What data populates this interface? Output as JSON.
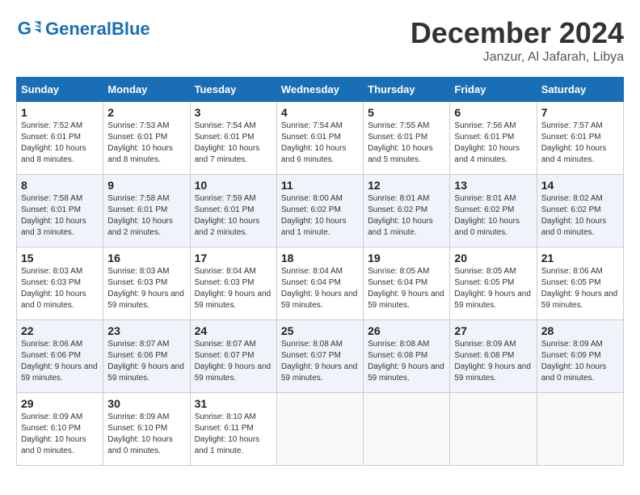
{
  "header": {
    "logo_general": "General",
    "logo_blue": "Blue",
    "month": "December 2024",
    "location": "Janzur, Al Jafarah, Libya"
  },
  "weekdays": [
    "Sunday",
    "Monday",
    "Tuesday",
    "Wednesday",
    "Thursday",
    "Friday",
    "Saturday"
  ],
  "weeks": [
    [
      {
        "day": 1,
        "sunrise": "7:52 AM",
        "sunset": "6:01 PM",
        "daylight": "10 hours and 8 minutes."
      },
      {
        "day": 2,
        "sunrise": "7:53 AM",
        "sunset": "6:01 PM",
        "daylight": "10 hours and 8 minutes."
      },
      {
        "day": 3,
        "sunrise": "7:54 AM",
        "sunset": "6:01 PM",
        "daylight": "10 hours and 7 minutes."
      },
      {
        "day": 4,
        "sunrise": "7:54 AM",
        "sunset": "6:01 PM",
        "daylight": "10 hours and 6 minutes."
      },
      {
        "day": 5,
        "sunrise": "7:55 AM",
        "sunset": "6:01 PM",
        "daylight": "10 hours and 5 minutes."
      },
      {
        "day": 6,
        "sunrise": "7:56 AM",
        "sunset": "6:01 PM",
        "daylight": "10 hours and 4 minutes."
      },
      {
        "day": 7,
        "sunrise": "7:57 AM",
        "sunset": "6:01 PM",
        "daylight": "10 hours and 4 minutes."
      }
    ],
    [
      {
        "day": 8,
        "sunrise": "7:58 AM",
        "sunset": "6:01 PM",
        "daylight": "10 hours and 3 minutes."
      },
      {
        "day": 9,
        "sunrise": "7:58 AM",
        "sunset": "6:01 PM",
        "daylight": "10 hours and 2 minutes."
      },
      {
        "day": 10,
        "sunrise": "7:59 AM",
        "sunset": "6:01 PM",
        "daylight": "10 hours and 2 minutes."
      },
      {
        "day": 11,
        "sunrise": "8:00 AM",
        "sunset": "6:02 PM",
        "daylight": "10 hours and 1 minute."
      },
      {
        "day": 12,
        "sunrise": "8:01 AM",
        "sunset": "6:02 PM",
        "daylight": "10 hours and 1 minute."
      },
      {
        "day": 13,
        "sunrise": "8:01 AM",
        "sunset": "6:02 PM",
        "daylight": "10 hours and 0 minutes."
      },
      {
        "day": 14,
        "sunrise": "8:02 AM",
        "sunset": "6:02 PM",
        "daylight": "10 hours and 0 minutes."
      }
    ],
    [
      {
        "day": 15,
        "sunrise": "8:03 AM",
        "sunset": "6:03 PM",
        "daylight": "10 hours and 0 minutes."
      },
      {
        "day": 16,
        "sunrise": "8:03 AM",
        "sunset": "6:03 PM",
        "daylight": "9 hours and 59 minutes."
      },
      {
        "day": 17,
        "sunrise": "8:04 AM",
        "sunset": "6:03 PM",
        "daylight": "9 hours and 59 minutes."
      },
      {
        "day": 18,
        "sunrise": "8:04 AM",
        "sunset": "6:04 PM",
        "daylight": "9 hours and 59 minutes."
      },
      {
        "day": 19,
        "sunrise": "8:05 AM",
        "sunset": "6:04 PM",
        "daylight": "9 hours and 59 minutes."
      },
      {
        "day": 20,
        "sunrise": "8:05 AM",
        "sunset": "6:05 PM",
        "daylight": "9 hours and 59 minutes."
      },
      {
        "day": 21,
        "sunrise": "8:06 AM",
        "sunset": "6:05 PM",
        "daylight": "9 hours and 59 minutes."
      }
    ],
    [
      {
        "day": 22,
        "sunrise": "8:06 AM",
        "sunset": "6:06 PM",
        "daylight": "9 hours and 59 minutes."
      },
      {
        "day": 23,
        "sunrise": "8:07 AM",
        "sunset": "6:06 PM",
        "daylight": "9 hours and 59 minutes."
      },
      {
        "day": 24,
        "sunrise": "8:07 AM",
        "sunset": "6:07 PM",
        "daylight": "9 hours and 59 minutes."
      },
      {
        "day": 25,
        "sunrise": "8:08 AM",
        "sunset": "6:07 PM",
        "daylight": "9 hours and 59 minutes."
      },
      {
        "day": 26,
        "sunrise": "8:08 AM",
        "sunset": "6:08 PM",
        "daylight": "9 hours and 59 minutes."
      },
      {
        "day": 27,
        "sunrise": "8:09 AM",
        "sunset": "6:08 PM",
        "daylight": "9 hours and 59 minutes."
      },
      {
        "day": 28,
        "sunrise": "8:09 AM",
        "sunset": "6:09 PM",
        "daylight": "10 hours and 0 minutes."
      }
    ],
    [
      {
        "day": 29,
        "sunrise": "8:09 AM",
        "sunset": "6:10 PM",
        "daylight": "10 hours and 0 minutes."
      },
      {
        "day": 30,
        "sunrise": "8:09 AM",
        "sunset": "6:10 PM",
        "daylight": "10 hours and 0 minutes."
      },
      {
        "day": 31,
        "sunrise": "8:10 AM",
        "sunset": "6:11 PM",
        "daylight": "10 hours and 1 minute."
      },
      null,
      null,
      null,
      null
    ]
  ]
}
